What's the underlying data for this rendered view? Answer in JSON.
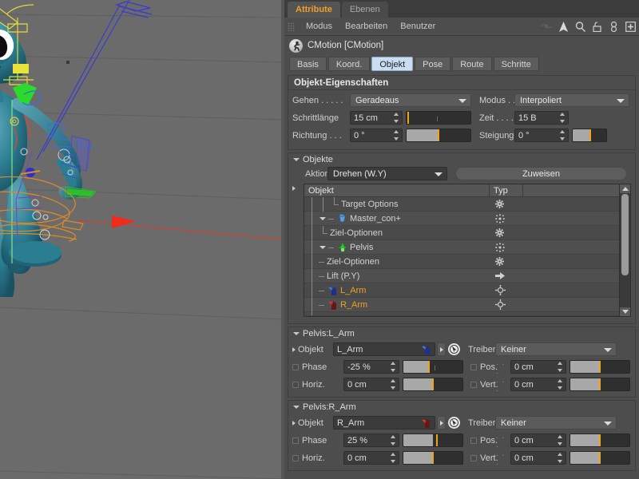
{
  "viewport": {
    "name": "3d-viewport",
    "background_color": "#6b6b6b",
    "description": "Perspective view of a rigged blue cartoon alien character with animation rig splines"
  },
  "panel_tabs": [
    {
      "label": "Attribute",
      "active": true
    },
    {
      "label": "Ebenen",
      "active": false
    }
  ],
  "menubar": {
    "items": [
      "Modus",
      "Bearbeiten",
      "Benutzer"
    ],
    "icons": [
      "lasso-icon",
      "arrow-cursor-icon",
      "search-icon",
      "unlock-icon",
      "link-icon",
      "add-box-icon"
    ]
  },
  "object_header": {
    "icon": "cmotion-running-figure-icon",
    "title": "CMotion [CMotion]"
  },
  "mode_tabs": [
    {
      "label": "Basis",
      "active": false
    },
    {
      "label": "Koord.",
      "active": false
    },
    {
      "label": "Objekt",
      "active": true
    },
    {
      "label": "Pose",
      "active": false
    },
    {
      "label": "Route",
      "active": false
    },
    {
      "label": "Schritte",
      "active": false
    }
  ],
  "object_properties": {
    "title": "Objekt-Eigenschaften",
    "gehen": {
      "label": "Gehen . . . . .",
      "value": "Geradeaus"
    },
    "modus": {
      "label": "Modus . . .",
      "value": "Interpoliert"
    },
    "schrittlaenge": {
      "label": "Schrittlänge",
      "value": "15 cm",
      "fill_pct": 0,
      "mark_pct": 2,
      "tick_pct": 48
    },
    "zeit": {
      "label": "Zeit . . . .",
      "value": "15 B"
    },
    "richtung": {
      "label": "Richtung . . .",
      "value": "0 °",
      "fill_pct": 50,
      "mark_pct": 49
    },
    "steigung": {
      "label": "Steigung",
      "value": "0 °",
      "fill_pct": 50,
      "mark_pct": 49
    }
  },
  "objekte_group": {
    "label": "Objekte",
    "aktion": {
      "label": "Aktion",
      "value": "Drehen (W.Y)"
    },
    "assign_button": "Zuweisen",
    "tree": {
      "columns": [
        "Objekt",
        "Typ"
      ],
      "rows": [
        {
          "name": "Target Options",
          "indent": 3,
          "connector": "elbow",
          "icon": "",
          "type_icon": "gear-icon",
          "highlight": false,
          "expander": ""
        },
        {
          "name": "Master_con+",
          "indent": 2,
          "connector": "dash",
          "icon": "null-object-icon-blue",
          "type_icon": "move-dots-icon",
          "highlight": false,
          "expander": "down"
        },
        {
          "name": "Ziel-Optionen",
          "indent": 2,
          "connector": "elbow",
          "icon": "",
          "type_icon": "gear-icon",
          "highlight": false,
          "expander": ""
        },
        {
          "name": "Pelvis",
          "indent": 2,
          "connector": "dash",
          "icon": "joint-icon-green",
          "type_icon": "move-dots-icon",
          "highlight": false,
          "expander": "down"
        },
        {
          "name": "Ziel-Optionen",
          "indent": 2,
          "connector": "dash",
          "icon": "",
          "type_icon": "gear-icon",
          "highlight": false,
          "expander": ""
        },
        {
          "name": "Lift (P.Y)",
          "indent": 2,
          "connector": "dash",
          "icon": "",
          "type_icon": "arrow-right-icon",
          "highlight": false,
          "expander": ""
        },
        {
          "name": "L_Arm",
          "indent": 2,
          "connector": "dash",
          "icon": "hand-icon-blue",
          "type_icon": "target-cross-icon",
          "highlight": true,
          "expander": ""
        },
        {
          "name": "R_Arm",
          "indent": 2,
          "connector": "dash",
          "icon": "hand-icon-red",
          "type_icon": "target-cross-icon",
          "highlight": true,
          "expander": ""
        }
      ]
    }
  },
  "limb_panels": [
    {
      "title": "Pelvis:L_Arm",
      "objekt": {
        "label": "Objekt",
        "value": "L_Arm",
        "icon": "hand-icon-blue"
      },
      "treiber": {
        "label": "Treiber",
        "value": "Keiner"
      },
      "phase": {
        "label": "Phase",
        "value": "-25 %",
        "fill_pct": 43,
        "mark_pct": 43,
        "tick_pct": 53
      },
      "pos": {
        "label": "Pos.",
        "value": "0 cm",
        "fill_pct": 50,
        "mark_pct": 50
      },
      "horiz": {
        "label": "Horiz.",
        "value": "0 cm",
        "fill_pct": 50,
        "mark_pct": 50
      },
      "vert": {
        "label": "Vert.",
        "value": "0 cm",
        "fill_pct": 50,
        "mark_pct": 50
      }
    },
    {
      "title": "Pelvis:R_Arm",
      "objekt": {
        "label": "Objekt",
        "value": "R_Arm",
        "icon": "hand-icon-red"
      },
      "treiber": {
        "label": "Treiber",
        "value": "Keiner"
      },
      "phase": {
        "label": "Phase",
        "value": "25 %",
        "fill_pct": 50,
        "mark_pct": 56,
        "tick_pct": -1
      },
      "pos": {
        "label": "Pos.",
        "value": "0 cm",
        "fill_pct": 50,
        "mark_pct": 50
      },
      "horiz": {
        "label": "Horiz.",
        "value": "0 cm",
        "fill_pct": 50,
        "mark_pct": 50
      },
      "vert": {
        "label": "Vert.",
        "value": "0 cm",
        "fill_pct": 50,
        "mark_pct": 50
      }
    }
  ],
  "colors": {
    "accent_orange": "#f0a020",
    "slider_mark": "#f2a218",
    "active_tab_blue": "#c9def5",
    "panel_bg": "#4d4d4d",
    "viewport_bg": "#6b6b6b"
  }
}
